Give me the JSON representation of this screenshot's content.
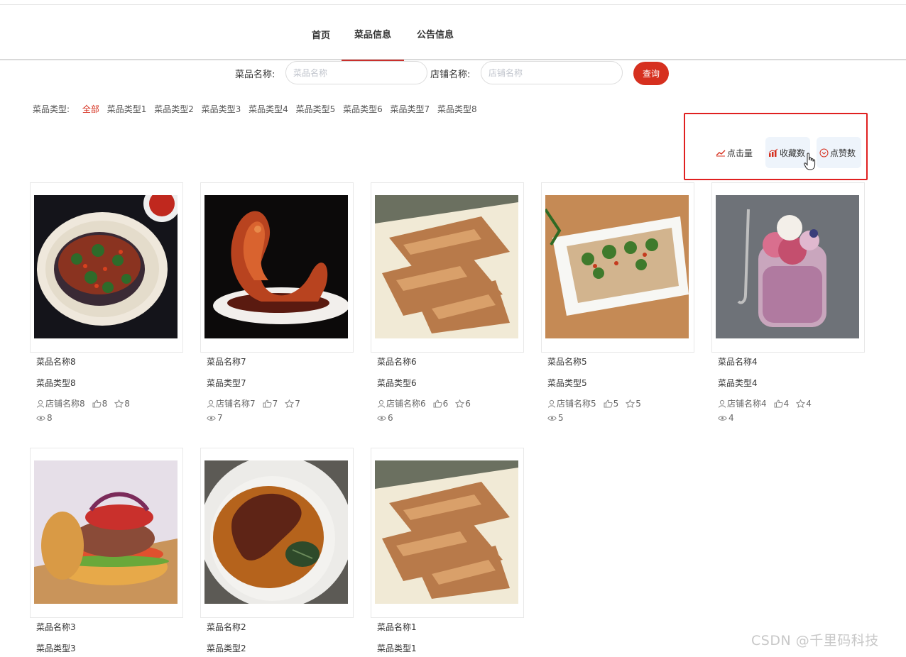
{
  "nav": {
    "items": [
      {
        "label": "首页"
      },
      {
        "label": "菜品信息",
        "active": true
      },
      {
        "label": "公告信息"
      }
    ]
  },
  "search": {
    "dish_label": "菜品名称:",
    "dish_placeholder": "菜品名称",
    "shop_label": "店铺名称:",
    "shop_placeholder": "店铺名称",
    "query_label": "查询"
  },
  "types": {
    "label": "菜品类型:",
    "items": [
      "全部",
      "菜品类型1",
      "菜品类型2",
      "菜品类型3",
      "菜品类型4",
      "菜品类型5",
      "菜品类型6",
      "菜品类型7",
      "菜品类型8"
    ],
    "active_index": 0
  },
  "sort": {
    "clicks": "点击量",
    "favorites": "收藏数",
    "likes": "点赞数"
  },
  "cards": [
    {
      "name": "菜品名称8",
      "type": "菜品类型8",
      "shop": "店铺名称8",
      "likes": "8",
      "favorites": "8",
      "views": "8",
      "image": "chili-eggplant-plate"
    },
    {
      "name": "菜品名称7",
      "type": "菜品类型7",
      "shop": "店铺名称7",
      "likes": "7",
      "favorites": "7",
      "views": "7",
      "image": "glazed-duck-sculpture"
    },
    {
      "name": "菜品名称6",
      "type": "菜品类型6",
      "shop": "店铺名称6",
      "likes": "6",
      "favorites": "6",
      "views": "6",
      "image": "braised-meat-slices"
    },
    {
      "name": "菜品名称5",
      "type": "菜品类型5",
      "shop": "店铺名称5",
      "likes": "5",
      "favorites": "5",
      "views": "5",
      "image": "noodles-herbs-platter"
    },
    {
      "name": "菜品名称4",
      "type": "菜品类型4",
      "shop": "店铺名称4",
      "likes": "4",
      "favorites": "4",
      "views": "4",
      "image": "berry-parfait-jar"
    },
    {
      "name": "菜品名称3",
      "type": "菜品类型3",
      "image": "burger"
    },
    {
      "name": "菜品名称2",
      "type": "菜品类型2",
      "image": "braised-duck-feet"
    },
    {
      "name": "菜品名称1",
      "type": "菜品类型1",
      "image": "braised-meat-slices"
    }
  ],
  "colors": {
    "accent": "#d6301f",
    "highlight_box": "#e02020"
  },
  "watermark": "CSDN @千里码科技"
}
